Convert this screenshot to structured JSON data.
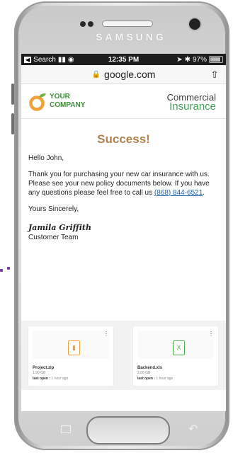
{
  "device": {
    "brand": "SAMSUNG"
  },
  "status_bar": {
    "back_app": "Search",
    "time": "12:35 PM",
    "battery": "97%"
  },
  "browser": {
    "url": "google.com"
  },
  "email": {
    "company": {
      "line1": "YOUR",
      "line2": "COMPANY"
    },
    "product": {
      "line1": "Commercial",
      "line2": "Insurance"
    },
    "title": "Success!",
    "greeting": "Hello John,",
    "message": "Thank you for purchasing your new car insurance with us. Please see your new policy documents below. If you have any questions please feel free to call us",
    "phone": "(868) 844-6521",
    "message_end": ".",
    "closing": "Yours Sincerely,",
    "signature": "Jamila Griffith",
    "team": "Customer Team"
  },
  "files": [
    {
      "name": "Project.zip",
      "size": "1.90 GB",
      "last_open_label": "last open :",
      "last_open": "1 hour ago",
      "icon": "zip-file-icon",
      "color": "#f0a23a"
    },
    {
      "name": "Backend.xls",
      "size": "2.00 GB",
      "last_open_label": "last open :",
      "last_open": "1 hour ago",
      "icon": "excel-file-icon",
      "color": "#4caf50"
    }
  ],
  "colors": {
    "title": "#b0804e",
    "brand_green": "#3e8e3a",
    "insurance_green": "#3ea25a",
    "link": "#1d5fb0",
    "accent_dots": "#7a3aa8"
  }
}
